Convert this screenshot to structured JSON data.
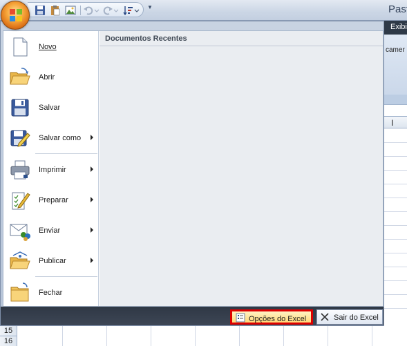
{
  "window": {
    "title": "Past"
  },
  "office_menu": {
    "commands": [
      {
        "label": "Novo",
        "mnemonic_index": 0,
        "has_submenu": false,
        "icon": "new-document-icon"
      },
      {
        "label": "Abrir",
        "mnemonic_index": 0,
        "has_submenu": false,
        "icon": "open-folder-icon"
      },
      {
        "label": "Salvar",
        "mnemonic_index": 0,
        "has_submenu": false,
        "icon": "save-disk-icon"
      },
      {
        "label": "Salvar como",
        "mnemonic_index": 7,
        "has_submenu": true,
        "icon": "save-as-icon"
      },
      {
        "label": "Imprimir",
        "mnemonic_index": 0,
        "has_submenu": true,
        "icon": "printer-icon"
      },
      {
        "label": "Preparar",
        "mnemonic_index": 0,
        "has_submenu": true,
        "icon": "prepare-icon"
      },
      {
        "label": "Enviar",
        "mnemonic_index": 0,
        "has_submenu": true,
        "icon": "send-icon"
      },
      {
        "label": "Publicar",
        "mnemonic_index": 0,
        "has_submenu": true,
        "icon": "publish-icon"
      },
      {
        "label": "Fechar",
        "mnemonic_index": 0,
        "has_submenu": false,
        "icon": "close-folder-icon"
      }
    ],
    "recent_documents": {
      "title": "Documentos Recentes",
      "items": []
    },
    "footer": {
      "options_label": "Opções do Excel",
      "exit_label": "Sair do Excel"
    }
  },
  "ribbon": {
    "tab_label": "Exibi",
    "group_text": "camer"
  },
  "sheet": {
    "column_header": "I",
    "row_numbers": [
      "15",
      "16"
    ]
  },
  "colors": {
    "highlight_border": "#dd0000",
    "menu_footer": "#2f3845",
    "office_orange": "#f6a53a"
  }
}
